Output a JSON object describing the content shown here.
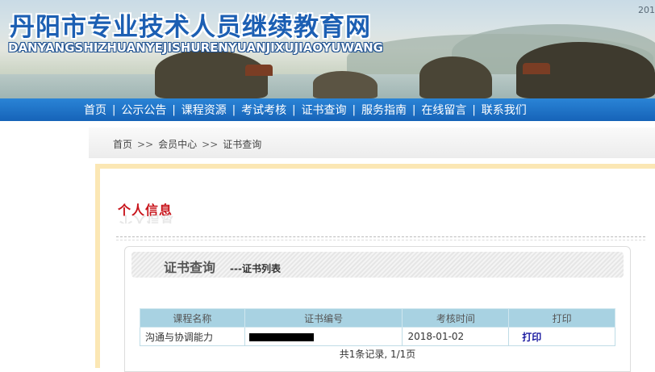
{
  "site": {
    "title": "丹阳市专业技术人员继续教育网",
    "pinyin": "DANYANGSHIZHUANYEJISHURENYUANJIXUJIAOYUWANG",
    "date_fragment": "201"
  },
  "nav": {
    "items": [
      {
        "label": "首页"
      },
      {
        "label": "公示公告"
      },
      {
        "label": "课程资源"
      },
      {
        "label": "考试考核"
      },
      {
        "label": "证书查询"
      },
      {
        "label": "服务指南"
      },
      {
        "label": "在线留言"
      },
      {
        "label": "联系我们"
      }
    ],
    "separator": "|"
  },
  "breadcrumb": {
    "items": [
      "首页",
      "会员中心",
      "证书查询"
    ],
    "separator": ">>"
  },
  "panel": {
    "title": "个人信息"
  },
  "box": {
    "title": "证书查询",
    "subtitle": "---证书列表"
  },
  "table": {
    "headers": [
      "课程名称",
      "证书编号",
      "考核时间",
      "打印"
    ],
    "rows": [
      {
        "course": "沟通与协调能力",
        "cert_no": "",
        "exam_time": "2018-01-02",
        "action": "打印"
      }
    ]
  },
  "pager": {
    "text": "共1条记录, 1/1页"
  }
}
